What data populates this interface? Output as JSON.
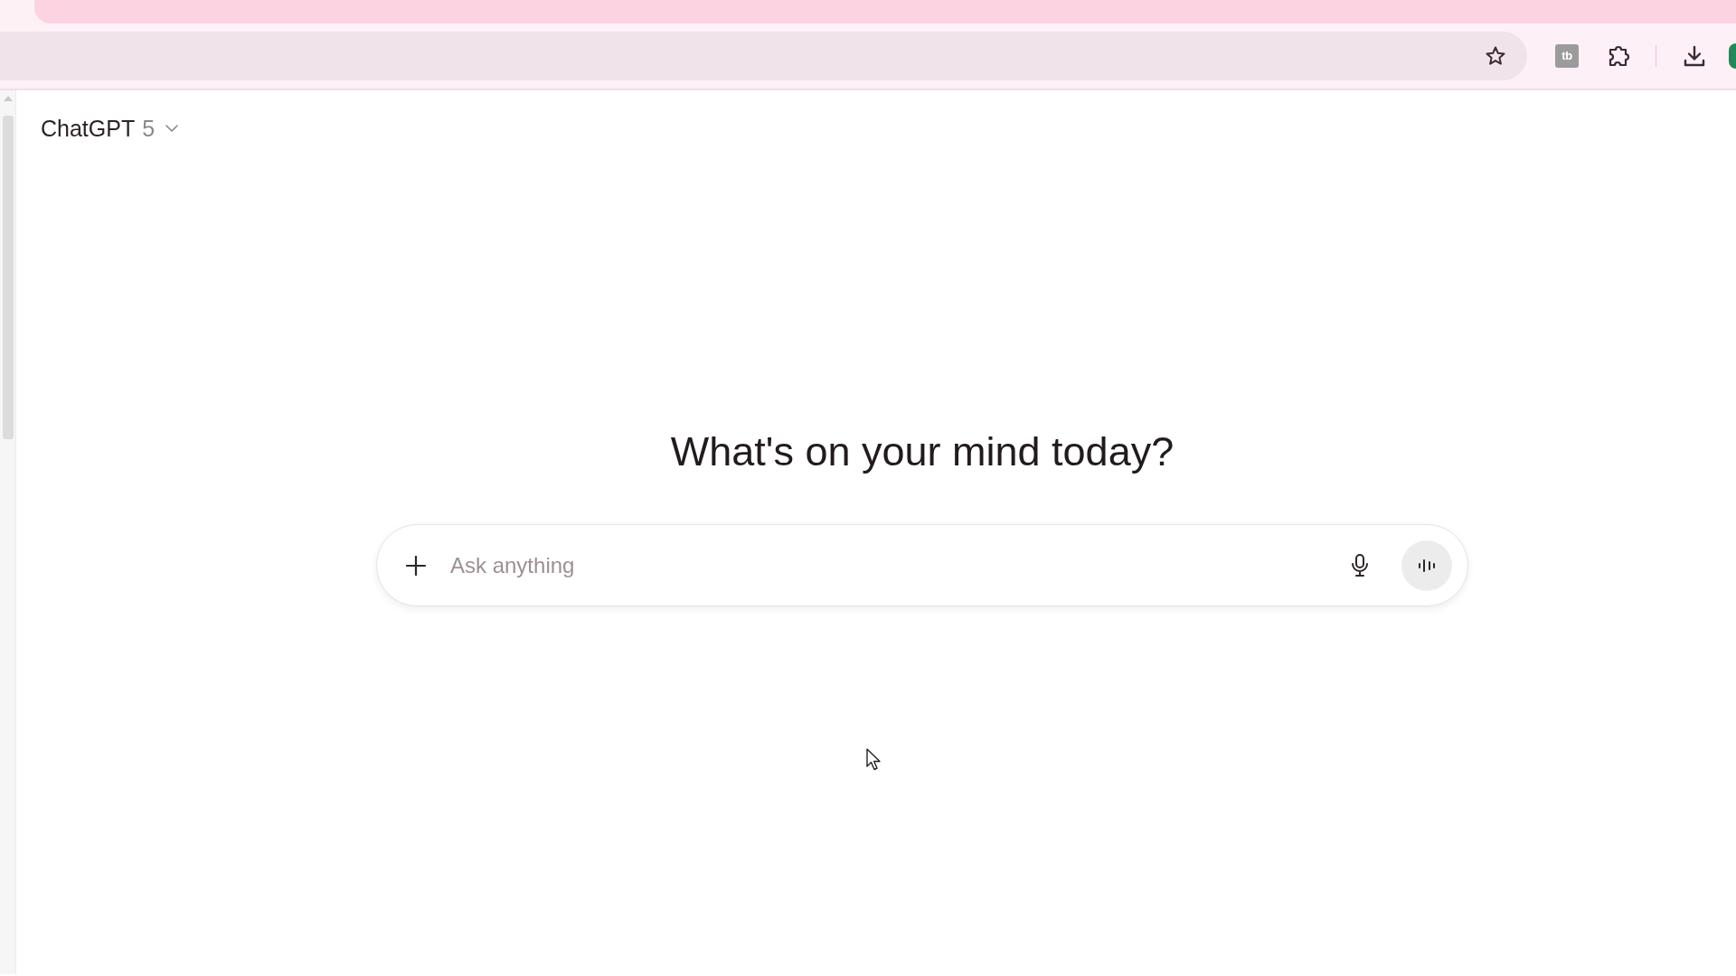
{
  "browser": {
    "extension_badge": "tb"
  },
  "header": {
    "model_name": "ChatGPT",
    "model_version": "5"
  },
  "heading": "What's on your mind today?",
  "composer": {
    "placeholder": "Ask anything"
  }
}
